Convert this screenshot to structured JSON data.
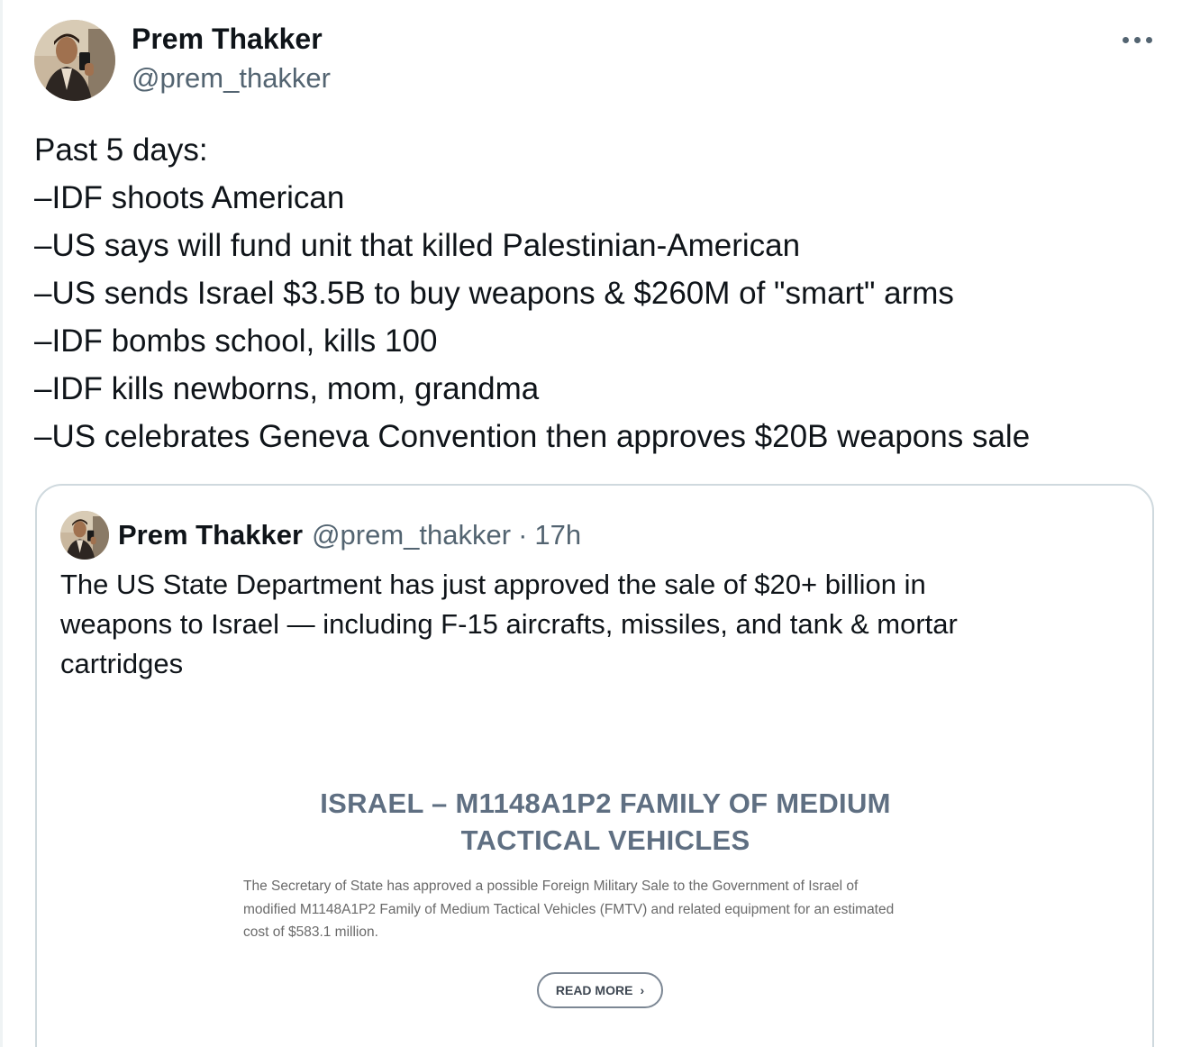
{
  "author": {
    "name": "Prem Thakker",
    "handle": "@prem_thakker",
    "avatar_icon": "user-avatar-photo"
  },
  "more_icon": "more-horizontal-icon",
  "tweet_lines": [
    "Past 5 days:",
    "–IDF shoots American",
    "–US says will fund unit that killed Palestinian-American",
    "–US sends Israel $3.5B to buy weapons & $260M of \"smart\" arms",
    "–IDF bombs school, kills 100",
    "–IDF kills newborns, mom, grandma",
    "–US celebrates Geneva Convention then approves $20B weapons sale"
  ],
  "quoted": {
    "name": "Prem Thakker",
    "handle": "@prem_thakker",
    "separator": "·",
    "time": "17h",
    "text_lines": [
      "The US State Department has just approved the sale of $20+ billion in",
      "weapons to Israel — including F-15 aircrafts, missiles, and tank & mortar",
      "cartridges"
    ],
    "media": {
      "title_lines": [
        "ISRAEL – M1148A1P2 FAMILY OF MEDIUM",
        "TACTICAL VEHICLES"
      ],
      "desc_lines": [
        "The Secretary of State has approved a possible Foreign Military Sale to the Government of Israel of",
        "modified M1148A1P2 Family of Medium Tactical Vehicles (FMTV) and related equipment for an estimated",
        "cost of $583.1 million."
      ],
      "button_label": "READ MORE",
      "button_chevron": "›"
    }
  },
  "colors": {
    "text": "#0f1419",
    "secondary": "#536471",
    "border": "#cfd9de",
    "media_title": "#5f6f82"
  }
}
